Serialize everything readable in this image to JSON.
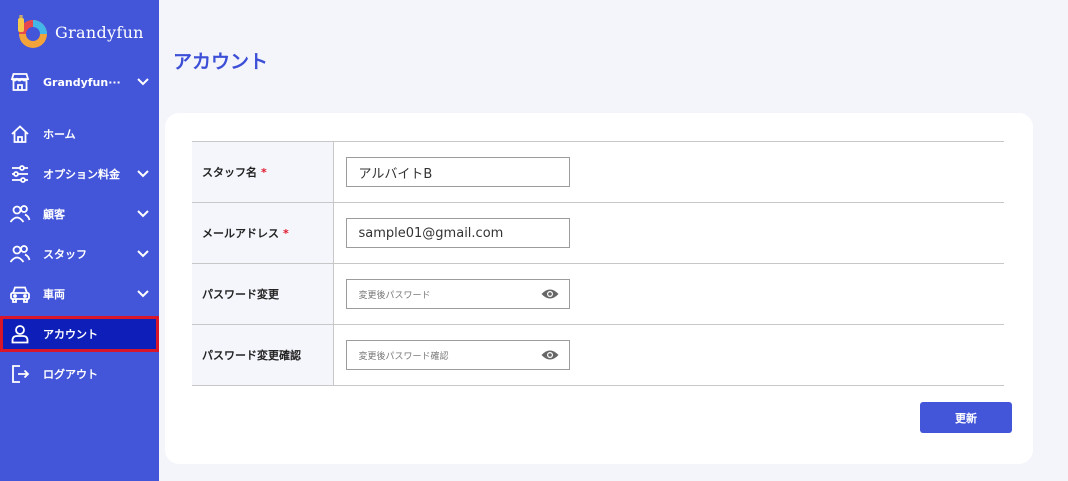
{
  "brand": {
    "name": "Grandyfun"
  },
  "store_selector": {
    "label": "Grandyfun···"
  },
  "sidebar": {
    "items": [
      {
        "label": "ホーム"
      },
      {
        "label": "オプション料金"
      },
      {
        "label": "顧客"
      },
      {
        "label": "スタッフ"
      },
      {
        "label": "車両"
      },
      {
        "label": "アカウント"
      },
      {
        "label": "ログアウト"
      }
    ]
  },
  "page": {
    "title": "アカウント"
  },
  "form": {
    "rows": [
      {
        "label": "スタッフ名",
        "required": "*",
        "value": "アルバイトB"
      },
      {
        "label": "メールアドレス",
        "required": "*",
        "value": "sample01@gmail.com"
      },
      {
        "label": "パスワード変更",
        "placeholder": "変更後パスワード"
      },
      {
        "label": "パスワード変更確認",
        "placeholder": "変更後パスワード確認"
      }
    ],
    "submit_label": "更新"
  },
  "colors": {
    "sidebar_bg": "#4355d9",
    "active_bg": "#0d1fb8",
    "active_outline": "#d9152a",
    "accent": "#3c4fd6",
    "required": "#e0182c"
  }
}
